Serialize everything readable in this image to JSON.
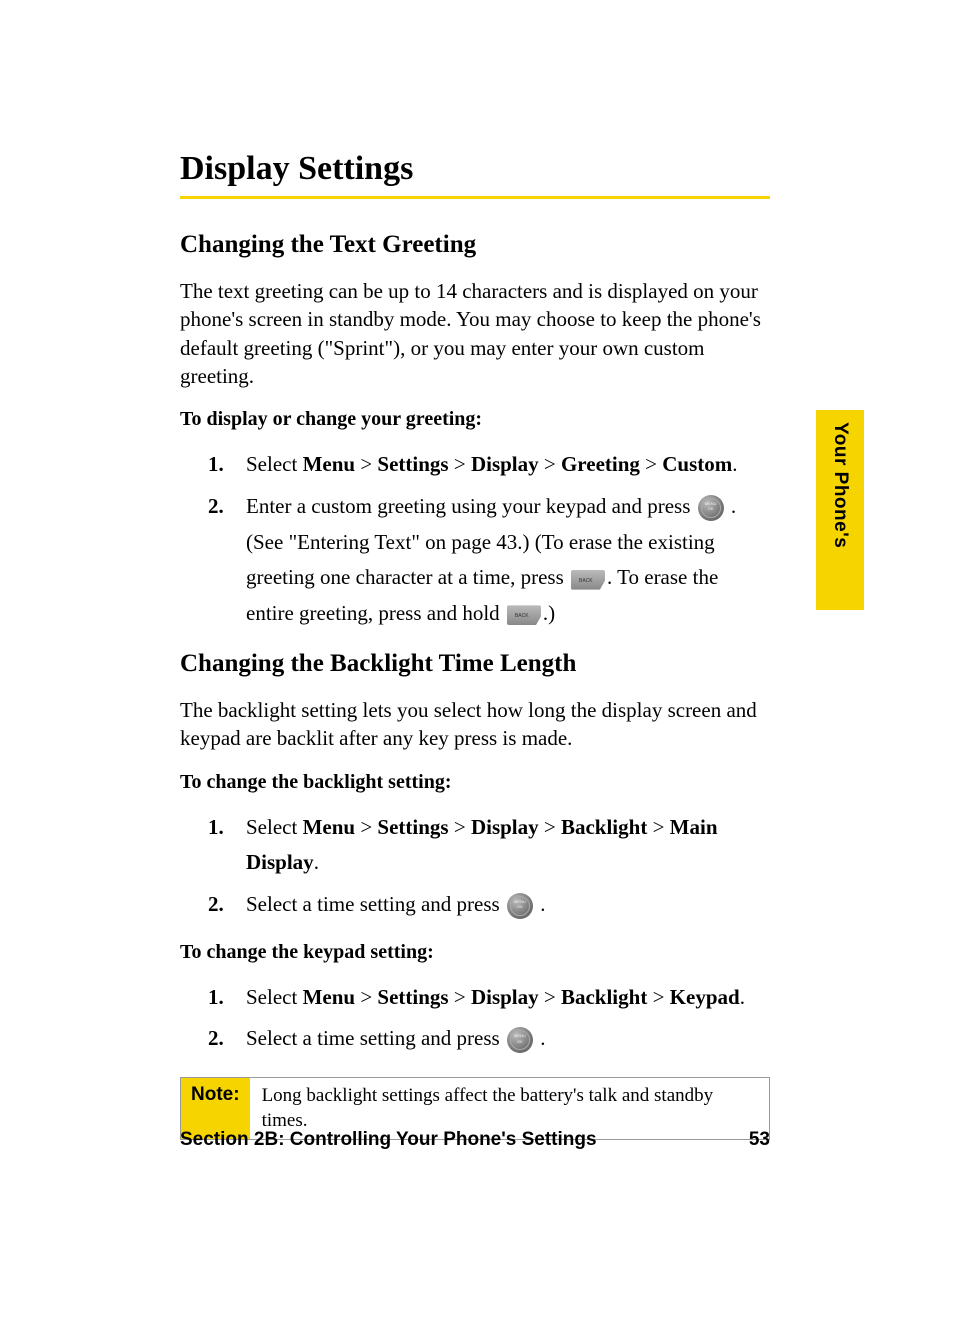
{
  "heading": "Display Settings",
  "section1": {
    "title": "Changing the Text Greeting",
    "para": "The text greeting can be up to 14 characters and is displayed on your phone's screen in standby mode. You may choose to keep the phone's default greeting (\"Sprint\"), or you may enter your own custom greeting.",
    "lead": "To display or change your greeting:",
    "step1_prefix": "Select ",
    "step1_menu": "Menu",
    "step1_settings": "Settings",
    "step1_display": "Display",
    "step1_greeting": "Greeting",
    "step1_custom": "Custom",
    "sep": " > ",
    "period": ".",
    "step2_a": "Enter a custom greeting using your keypad and press ",
    "step2_b": " . (See \"Entering Text\" on page 43.) (To erase the existing greeting one character at a time, press ",
    "step2_c": ". To erase the entire greeting, press and hold ",
    "step2_d": ".)"
  },
  "section2": {
    "title": "Changing the Backlight Time Length",
    "para": "The backlight setting lets you select how long the display screen and keypad are backlit after any key press is made.",
    "lead1": "To change the backlight setting:",
    "bl1_prefix": "Select ",
    "bl1_menu": "Menu",
    "bl1_settings": "Settings",
    "bl1_display": "Display",
    "bl1_backlight": "Backlight",
    "bl1_main": "Main Display",
    "bl_step2": "Select a time setting and press ",
    "bl_step2_suffix": " .",
    "lead2": "To change the keypad setting:",
    "kp1_prefix": "Select ",
    "kp1_menu": "Menu",
    "kp1_settings": "Settings",
    "kp1_display": "Display",
    "kp1_backlight": "Backlight",
    "kp1_keypad": "Keypad"
  },
  "note": {
    "label": "Note:",
    "text": "Long backlight settings affect the battery's talk and standby times."
  },
  "sidetab": "Your Phone's",
  "footer": {
    "left": "Section 2B: Controlling Your Phone's Settings",
    "right": "53"
  }
}
